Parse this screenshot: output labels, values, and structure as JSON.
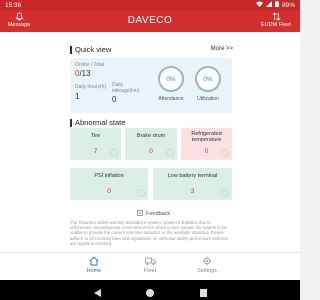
{
  "status_bar": {
    "time": "15:36",
    "battery": "89%"
  },
  "app_bar": {
    "title": "DAVECO",
    "left_label": "Message",
    "right_label": "EUDM Fleet"
  },
  "quick_view": {
    "title": "Quick view",
    "more_label": "More >>",
    "online_label": "Online / Total",
    "online_value": "0",
    "total_value": "/13",
    "daily_hours_label": "Daily hours(h)",
    "daily_hours_value": "1",
    "daily_mileage_label": "Daily mileage(km)",
    "daily_mileage_value": "0",
    "attendance_value": "0%",
    "attendance_label": "Attendance",
    "utilization_value": "0%",
    "utilization_label": "Utilization"
  },
  "abnormal_state": {
    "title": "Abnormal state",
    "items": [
      {
        "label": "Tire",
        "count": "7",
        "count_color": "#d32f2f"
      },
      {
        "label": "Brake drum",
        "count": "0",
        "count_color": "#d32f2f"
      },
      {
        "label": "Refrigerated temperature",
        "count": "0",
        "count_color": "#d32f2f"
      },
      {
        "label": "PSI inflation",
        "count": "0",
        "count_color": "#d32f2f"
      },
      {
        "label": "Low battery terminal",
        "count": "3",
        "count_color": "#d32f2f"
      }
    ]
  },
  "feedback_label": "Feedback",
  "disclaimer": "The SmartGo safety warning assistance system, system's statistics due to unforeseen circumstances or terminal errors which in turn causes the system to be unable to provide the current real-time statistics or the available statistics. Please adhere to all courtesy laws and regulations on vehicular safety and ensure vehicles are regularly checked.",
  "tabs": [
    {
      "label": "Home",
      "icon": "home-icon"
    },
    {
      "label": "Fleet",
      "icon": "truck-icon"
    },
    {
      "label": "Settings",
      "icon": "gear-icon"
    }
  ],
  "colors": {
    "brand_red": "#d32f2f",
    "accent_blue": "#2e6fba",
    "card_green": "#dbefe4",
    "card_pink": "#fbe1e1",
    "quick_bg": "#e8f4f8"
  }
}
